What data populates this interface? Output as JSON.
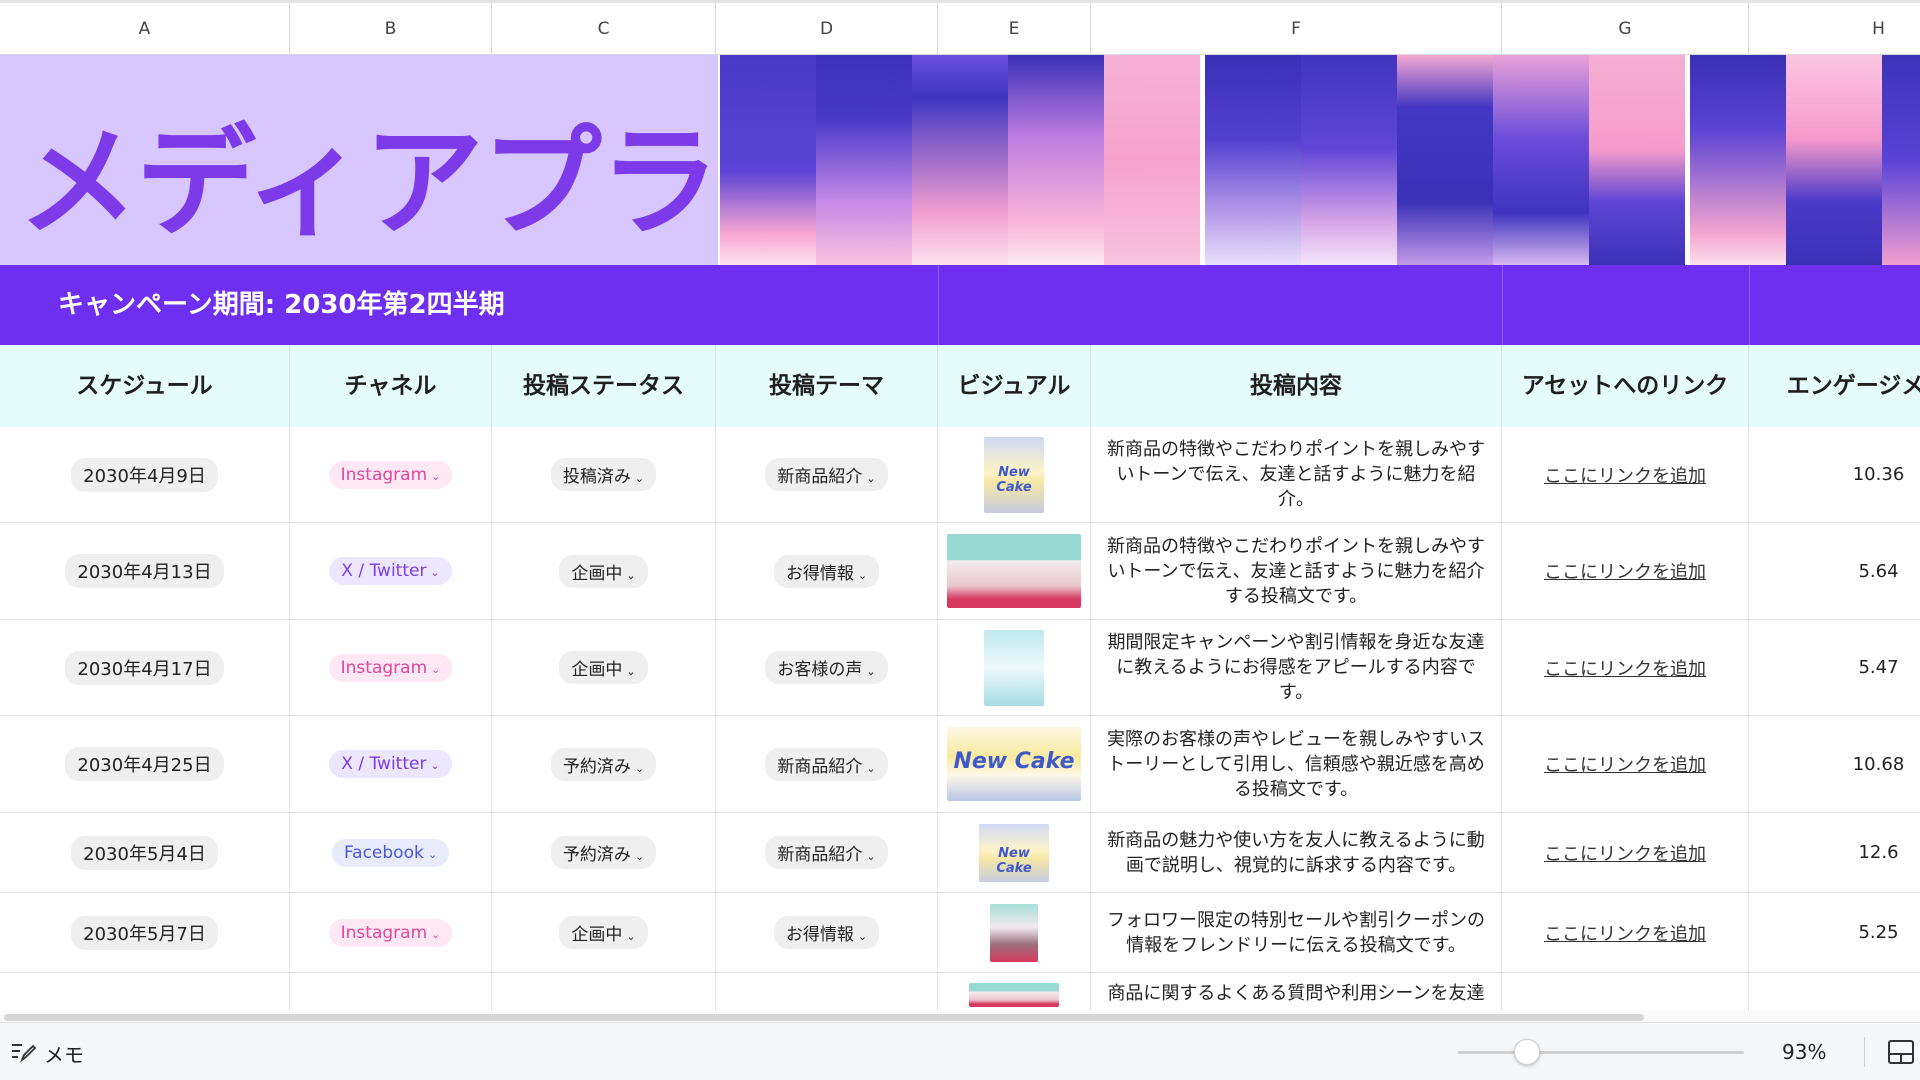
{
  "columns": [
    "A",
    "B",
    "C",
    "D",
    "E",
    "F",
    "G",
    "H"
  ],
  "banner": {
    "title": "メディアプラン"
  },
  "campaign": {
    "label": "キャンペーン期間: 2030年第2四半期"
  },
  "headers": [
    "スケジュール",
    "チャネル",
    "投稿ステータス",
    "投稿テーマ",
    "ビジュアル",
    "投稿内容",
    "アセットへのリンク",
    "エンゲージメント"
  ],
  "rows": [
    {
      "date": "2030年4月9日",
      "channel": "Instagram",
      "status": "投稿済み",
      "theme": "新商品紹介",
      "visual": "cake-photo",
      "content": "新商品の特徴やこだわりポイントを親しみやすいトーンで伝え、友達と話すように魅力を紹介。",
      "link": "ここにリンクを追加",
      "engagement": "10.36"
    },
    {
      "date": "2030年4月13日",
      "channel": "X / Twitter",
      "status": "企画中",
      "theme": "お得情報",
      "visual": "campaign-banner",
      "content": "新商品の特徴やこだわりポイントを親しみやすいトーンで伝え、友達と話すように魅力を紹介する投稿文です。",
      "link": "ここにリンクを追加",
      "engagement": "5.64"
    },
    {
      "date": "2030年4月17日",
      "channel": "Instagram",
      "status": "企画中",
      "theme": "お客様の声",
      "visual": "testimonial-card",
      "content": "期間限定キャンペーンや割引情報を身近な友達に教えるようにお得感をアピールする内容です。",
      "link": "ここにリンクを追加",
      "engagement": "5.47"
    },
    {
      "date": "2030年4月25日",
      "channel": "X / Twitter",
      "status": "予約済み",
      "theme": "新商品紹介",
      "visual": "cake-banner",
      "content": "実際のお客様の声やレビューを親しみやすいストーリーとして引用し、信頼感や親近感を高める投稿文です。",
      "link": "ここにリンクを追加",
      "engagement": "10.68"
    },
    {
      "date": "2030年5月4日",
      "channel": "Facebook",
      "status": "予約済み",
      "theme": "新商品紹介",
      "visual": "cake-photo",
      "content": "新商品の魅力や使い方を友人に教えるように動画で説明し、視覚的に訴求する内容です。",
      "link": "ここにリンクを追加",
      "engagement": "12.6"
    },
    {
      "date": "2030年5月7日",
      "channel": "Instagram",
      "status": "企画中",
      "theme": "お得情報",
      "visual": "coupon-card",
      "content": "フォロワー限定の特別セールや割引クーポンの情報をフレンドリーに伝える投稿文です。",
      "link": "ここにリンクを追加",
      "engagement": "5.25"
    },
    {
      "date": "",
      "channel": "",
      "status": "",
      "theme": "",
      "visual": "campaign-banner",
      "content": "商品に関するよくある質問や利用シーンを友達",
      "link": "",
      "engagement": ""
    }
  ],
  "thumb_caption": "New Cake",
  "statusbar": {
    "memo_label": "メモ",
    "zoom": "93%",
    "zoom_fraction": 0.24
  },
  "colors": {
    "accent": "#6f2ff0",
    "title": "#7c3ae8",
    "title_bg": "#d7c6ff",
    "header_bg": "#e6fbfb"
  }
}
